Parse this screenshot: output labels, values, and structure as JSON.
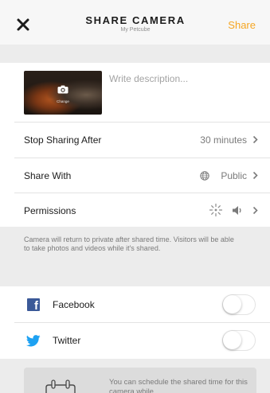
{
  "header": {
    "title": "SHARE CAMERA",
    "subtitle": "My Petcube",
    "share_label": "Share",
    "accent_color": "#f5a623"
  },
  "media": {
    "thumbnail_label": "Change",
    "description_placeholder": "Write description...",
    "description_value": ""
  },
  "settings": {
    "stop_sharing": {
      "label": "Stop Sharing After",
      "value": "30 minutes"
    },
    "share_with": {
      "label": "Share With",
      "value": "Public",
      "icon": "globe-icon"
    },
    "permissions": {
      "label": "Permissions",
      "icons": [
        "photo-icon",
        "sound-icon"
      ]
    }
  },
  "info": {
    "text": "Camera will return to private after shared time. Visitors will be able to take photos and videos while it's shared."
  },
  "social": [
    {
      "name": "Facebook",
      "icon": "facebook-icon",
      "enabled": false
    },
    {
      "name": "Twitter",
      "icon": "twitter-icon",
      "enabled": false
    }
  ],
  "schedule": {
    "text": "You can schedule the shared time for this camera while..."
  }
}
